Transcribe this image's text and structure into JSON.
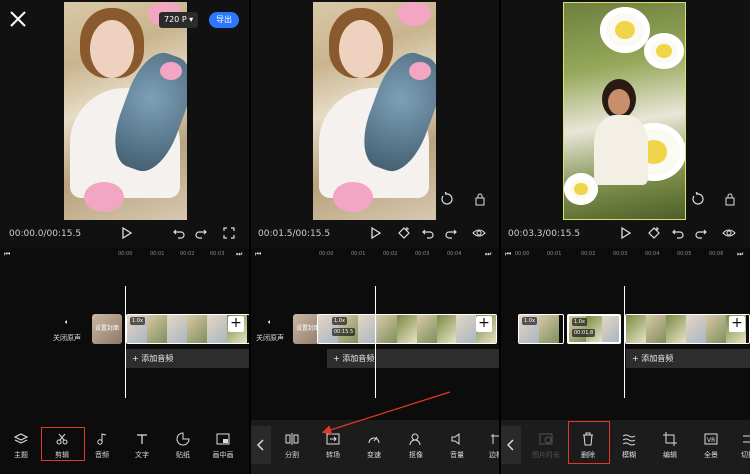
{
  "panel1": {
    "resolution": "720 P",
    "export": "导出",
    "time": "00:00.0/00:15.5",
    "ruler": [
      "00:00",
      "00:01",
      "00:02",
      "00:03",
      "00:04"
    ],
    "track_label": "关闭原声",
    "cover_label": "设置封面",
    "clip_speed": "1.0x",
    "add_audio": "+ 添加音频",
    "tools": [
      "主题",
      "剪辑",
      "音频",
      "文字",
      "贴纸",
      "画中画"
    ]
  },
  "panel2": {
    "time": "00:01.5/00:15.5",
    "ruler": [
      "00:00",
      "00:01",
      "00:02",
      "00:03",
      "00:04"
    ],
    "track_label": "关闭原声",
    "cover_label": "设置封面",
    "clip_speed": "1.0x",
    "clip_duration": "00:15.5",
    "add_audio": "+ 添加音频",
    "tools": [
      "分割",
      "转场",
      "变速",
      "抠像",
      "音量",
      "边框"
    ]
  },
  "panel3": {
    "time": "00:03.3/00:15.5",
    "ruler": [
      "00:00",
      "00:01",
      "00:02",
      "00:03",
      "00:04",
      "00:05",
      "00:06"
    ],
    "clip_speed": "1.0x",
    "clip_speed_b": "1.0x",
    "clip_duration": "00:01.8",
    "add_audio": "+ 添加音频",
    "tools": [
      "图片时长",
      "删除",
      "模糊",
      "编辑",
      "全景",
      "切换"
    ]
  },
  "colors": {
    "accent": "#2a78ff",
    "highlight": "#e0392b",
    "background": "#0c0c0c"
  }
}
